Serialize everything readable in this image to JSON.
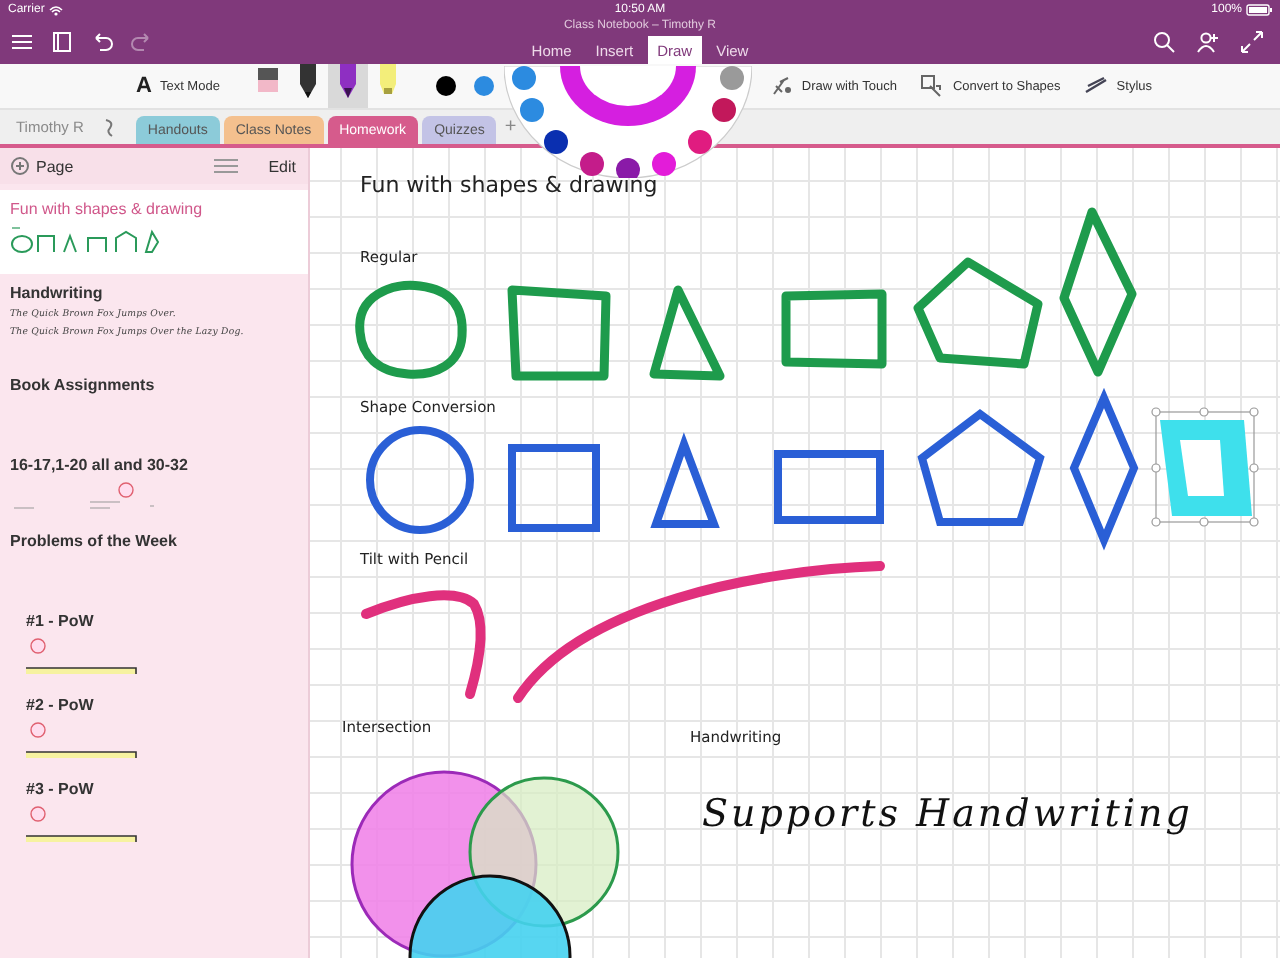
{
  "status_bar": {
    "carrier": "Carrier",
    "time": "10:50 AM",
    "battery": "100%"
  },
  "window": {
    "title": "Class Notebook – Timothy R"
  },
  "toolbar": {
    "undo": {
      "disabled": false
    },
    "redo": {
      "disabled": true
    }
  },
  "ribbon_tabs": [
    {
      "label": "Home",
      "selected": false
    },
    {
      "label": "Insert",
      "selected": false
    },
    {
      "label": "Draw",
      "selected": true
    },
    {
      "label": "View",
      "selected": false
    }
  ],
  "ribbon": {
    "text_mode": {
      "icon": "A",
      "label": "Text Mode"
    },
    "pens": [
      {
        "kind": "eraser",
        "color": "#f2b8c8",
        "selected": false
      },
      {
        "kind": "pencil",
        "color": "#333333",
        "selected": false
      },
      {
        "kind": "pen",
        "color": "#8e2fc2",
        "selected": true
      },
      {
        "kind": "highlighter",
        "color": "#f3ee7a",
        "selected": false
      }
    ],
    "colors": [
      {
        "color": "#000000"
      },
      {
        "color": "#2c8be0"
      }
    ],
    "tools": [
      {
        "kind": "touch",
        "label": "Draw with Touch"
      },
      {
        "kind": "shapes",
        "label": "Convert to Shapes"
      },
      {
        "kind": "stylus",
        "label": "Stylus"
      }
    ]
  },
  "notebook_owner": "Timothy R",
  "sections": [
    {
      "label": "Handouts",
      "color": "#8ccbd9",
      "selected": false
    },
    {
      "label": "Class Notes",
      "color": "#f4c08e",
      "selected": false
    },
    {
      "label": "Homework",
      "color": "#d65b8c",
      "selected": true
    },
    {
      "label": "Quizzes",
      "color": "#c3c3e6",
      "selected": false
    }
  ],
  "add_section": "+",
  "pages_pane": {
    "title": "Page",
    "edit": "Edit"
  },
  "pages": [
    {
      "title": "Fun with shapes & drawing",
      "kind": "shapes",
      "selected": true
    },
    {
      "title": "Handwriting",
      "kind": "handwriting",
      "selected": false,
      "lines": [
        "The Quick Brown Fox Jumps Over.",
        "The Quick Brown Fox Jumps Over the Lazy Dog."
      ]
    },
    {
      "title": "Book Assignments",
      "kind": "plain",
      "selected": false
    },
    {
      "title": "16-17,1-20 all and 30-32",
      "kind": "score",
      "selected": false
    },
    {
      "title": "Problems of the Week",
      "kind": "plain",
      "selected": false,
      "children": [
        {
          "title": "#1 - PoW",
          "kind": "pow",
          "selected": false
        },
        {
          "title": "#2 - PoW",
          "kind": "pow",
          "selected": false
        },
        {
          "title": "#3 - PoW",
          "kind": "pow",
          "selected": false
        }
      ]
    }
  ],
  "page": {
    "title": "Fun with shapes & drawing",
    "labels": [
      {
        "kind": "regular",
        "text": "Regular"
      },
      {
        "kind": "conversion",
        "text": "Shape Conversion"
      },
      {
        "kind": "tilt",
        "text": "Tilt with Pencil"
      },
      {
        "kind": "intersection",
        "text": "Intersection"
      },
      {
        "kind": "handwriting",
        "text": "Handwriting"
      }
    ],
    "handwriting": "Supports Handwriting"
  }
}
